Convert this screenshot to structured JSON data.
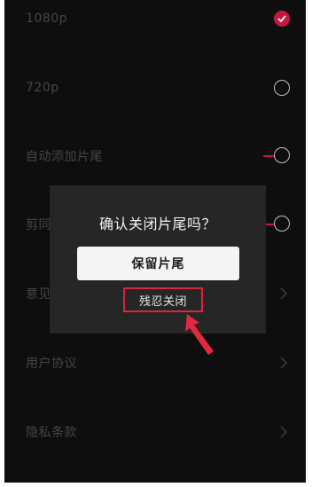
{
  "settings": {
    "resolution_1080": "1080p",
    "resolution_720": "720p",
    "auto_add_ending": "自动添加片尾",
    "clip_row_partial": "剪同",
    "feedback_partial": "意见",
    "user_agreement": "用户协议",
    "privacy_terms": "隐私条款"
  },
  "dialog": {
    "title": "确认关闭片尾吗？",
    "keep_label": "保留片尾",
    "close_label": "残忍关闭"
  },
  "colors": {
    "accent": "#c4163f",
    "highlight": "#d9263f",
    "background": "#0e0e0e",
    "dialog": "#262626"
  },
  "icons": {
    "selected": "check-icon",
    "unselected": "radio-circle-icon",
    "toggle": "toggle-switch-icon",
    "row_arrow": "chevron-right-icon",
    "annotation": "red-arrow-icon"
  }
}
